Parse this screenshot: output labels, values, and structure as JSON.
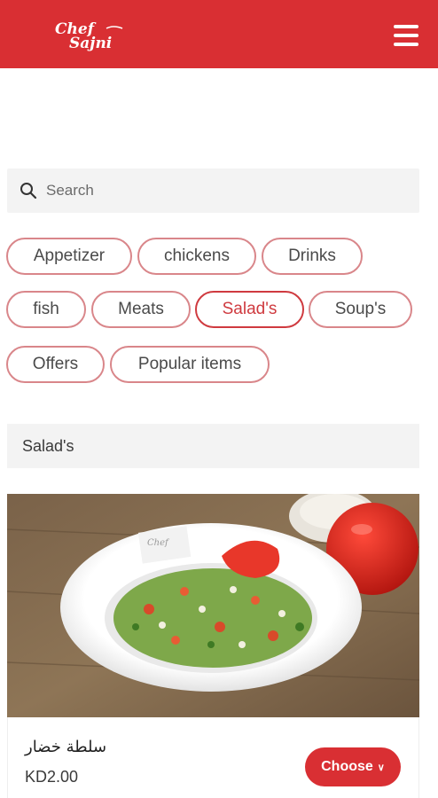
{
  "header": {
    "logo_text_line1": "Chef",
    "logo_text_line2": "Sajni",
    "brand_color": "#d92f33",
    "menu_icon": "hamburger-icon"
  },
  "search": {
    "placeholder": "Search",
    "icon": "search-icon"
  },
  "categories": [
    {
      "label": "Appetizer",
      "active": false
    },
    {
      "label": "chickens",
      "active": false
    },
    {
      "label": "Drinks",
      "active": false
    },
    {
      "label": "fish",
      "active": false
    },
    {
      "label": "Meats",
      "active": false
    },
    {
      "label": "Salad's",
      "active": true
    },
    {
      "label": "Soup's",
      "active": false
    },
    {
      "label": "Offers",
      "active": false
    },
    {
      "label": "Popular items",
      "active": false
    }
  ],
  "section": {
    "title": "Salad's"
  },
  "product": {
    "name": "سلطة خضار",
    "price": "KD2.00",
    "choose_label": "Choose",
    "choose_icon": "chevron-down-icon"
  }
}
